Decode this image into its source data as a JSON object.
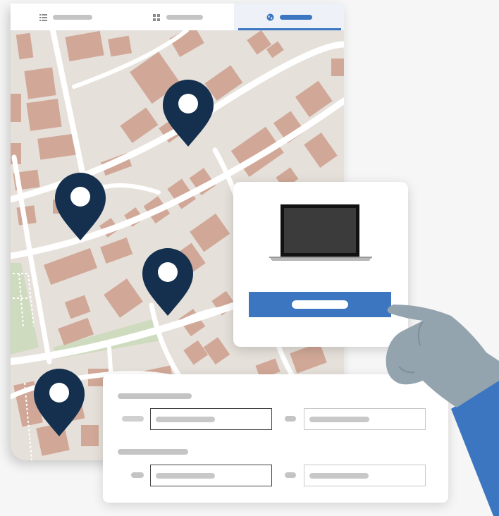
{
  "tabs": [
    {
      "icon": "list-icon",
      "active": false
    },
    {
      "icon": "grid-icon",
      "active": false
    },
    {
      "icon": "globe-icon",
      "active": true
    }
  ],
  "map": {
    "pins": [
      {
        "name": "map-pin-1"
      },
      {
        "name": "map-pin-2"
      },
      {
        "name": "map-pin-3"
      },
      {
        "name": "map-pin-4"
      }
    ]
  },
  "popup": {
    "device_icon": "laptop-icon"
  },
  "colors": {
    "accent": "#3d76c0",
    "pin": "#14304e",
    "building": "#d1a897",
    "park": "#cfdbbf",
    "map_bg": "#e6e0da",
    "hand": "#94a4ae"
  }
}
